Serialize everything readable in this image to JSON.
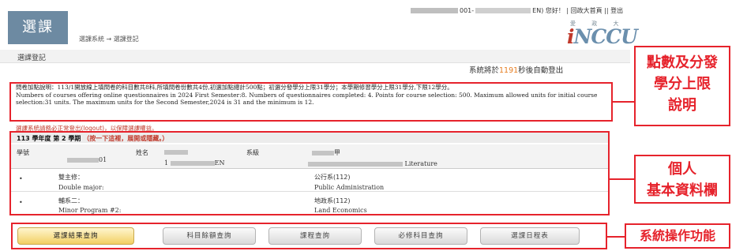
{
  "header": {
    "logo_text": "選課",
    "breadcrumb": "選課系統 → 選課登記",
    "top_links": {
      "id_prefix": "001-",
      "id_suffix": "EN",
      "greeting": ") 您好！",
      "home": "回政大首頁",
      "logout": "登出"
    },
    "brand_sub": "愛 政 大",
    "brand_i": "i",
    "brand_rest": "NCCU"
  },
  "page": {
    "title": "選課登記",
    "logout_prefix": "系統將於",
    "logout_seconds": "1191",
    "logout_suffix": "秒後自動登出"
  },
  "description": {
    "line_zh": "問卷加點說明：113/1開放線上填問卷的科目數共8科,所填問卷份數共4份,初選加點總計500點；初選分發學分上限31學分；本學期修習學分上限31學分,下限12學分。",
    "line_en": "Numbers of courses offering online questionnaires in 2024 First Semester:8. Numbers of questionnaires completed: 4. Points for course selection: 500. Maximum allowed units for initial course selection:31 units. The maximum units for the Second Semester,2024 is 31 and the minimum is 12."
  },
  "warning": "選課系統請務必正常登出(logout)，以保障選課權益。",
  "info": {
    "term_label": "113 學年度 第 2 學期",
    "term_hint": "（按一下這裡，展開或隱藏。）",
    "student_id_label": "學號",
    "student_id_suffix": "01",
    "name_label": "姓名",
    "name_prefix": "1",
    "name_suffix": "EN",
    "dept_label": "系級",
    "dept_grade": "甲",
    "dept_suffix": "Literature",
    "rows": [
      {
        "bullet": "•",
        "label_zh": "雙主修：",
        "label_en": "Double major:",
        "value_zh": "公行系(112)",
        "value_en": "Public Administration"
      },
      {
        "bullet": "•",
        "label_zh": "輔系二：",
        "label_en": "Minor Program #2:",
        "value_zh": "地政系(112)",
        "value_en": "Land Economics"
      }
    ]
  },
  "buttons": [
    {
      "label": "選課結果查詢",
      "active": true
    },
    {
      "label": "科目餘額查詢",
      "active": false
    },
    {
      "label": "課程查詢",
      "active": false
    },
    {
      "label": "必修科目查詢",
      "active": false
    },
    {
      "label": "選課日程表",
      "active": false
    }
  ],
  "annotations": {
    "desc_line1": "點數及分發",
    "desc_line2": "學分上限",
    "desc_line3": "說明",
    "info_line1": "個人",
    "info_line2": "基本資料欄",
    "buttons": "系統操作功能"
  },
  "colors": {
    "accent_red": "#e6232c",
    "logo_bg": "#6d8aa2",
    "active_button": "#f2cf63",
    "countdown": "#e67e22"
  }
}
